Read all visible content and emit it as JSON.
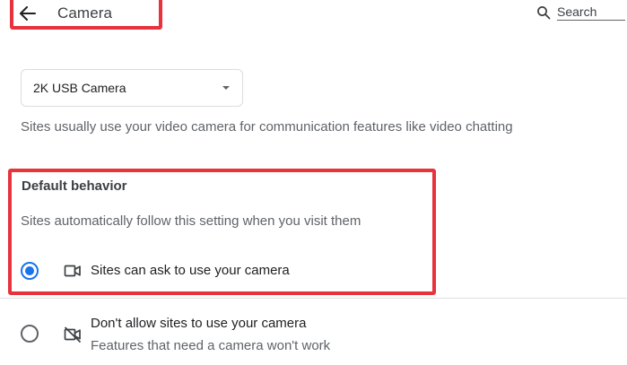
{
  "header": {
    "title": "Camera",
    "back_icon": "arrow-left-icon",
    "search_icon": "search-icon",
    "search_placeholder": "Search"
  },
  "camera_select": {
    "selected": "2K USB Camera",
    "icon": "caret-down-icon"
  },
  "description": "Sites usually use your video camera for communication features like video chatting",
  "default_behavior": {
    "heading": "Default behavior",
    "subtext": "Sites automatically follow this setting when you visit them",
    "options": [
      {
        "label": "Sites can ask to use your camera",
        "sublabel": "",
        "icon": "video-camera-icon",
        "selected": true
      },
      {
        "label": "Don't allow sites to use your camera",
        "sublabel": "Features that need a camera won't work",
        "icon": "video-camera-off-icon",
        "selected": false
      }
    ]
  },
  "colors": {
    "accent": "#1a73e8",
    "annotation": "#e8323c",
    "text_primary": "#202124",
    "text_secondary": "#5f6368"
  }
}
